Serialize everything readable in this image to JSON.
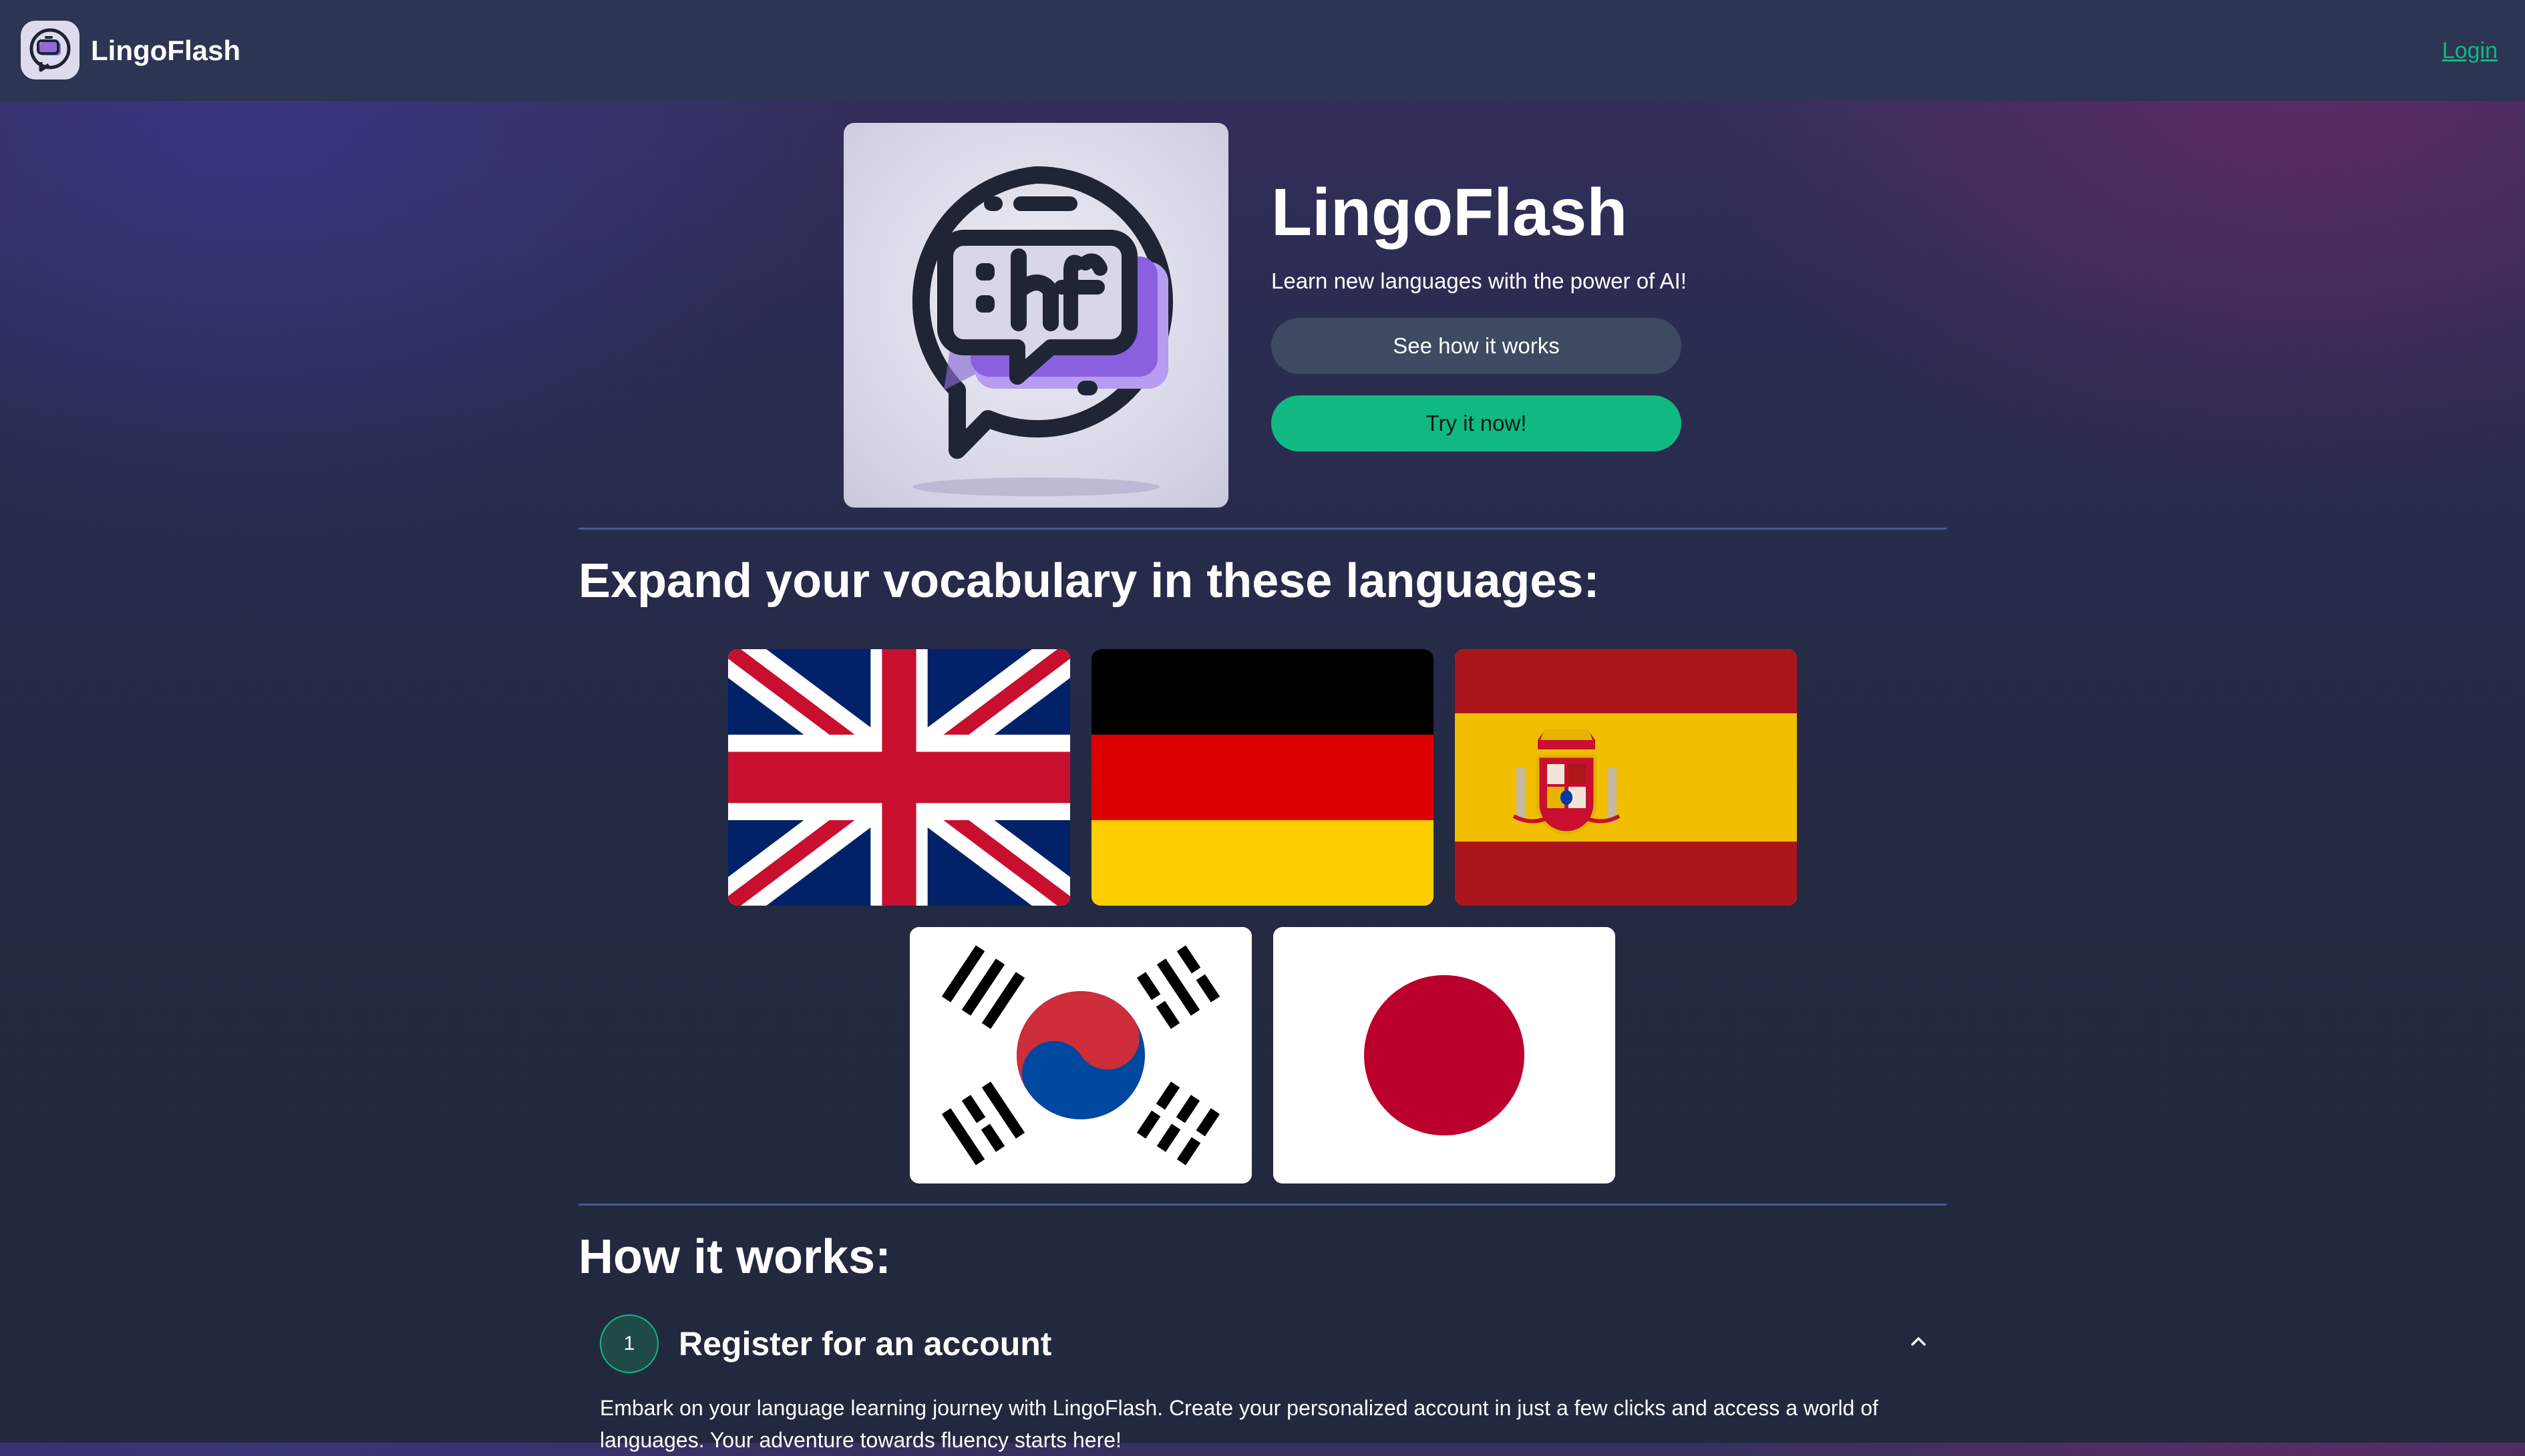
{
  "header": {
    "brand_name": "LingoFlash",
    "login_label": "Login"
  },
  "hero": {
    "title": "LingoFlash",
    "subtitle": "Learn new languages with the power of AI!",
    "secondary_button": "See how it works",
    "primary_button": "Try it now!"
  },
  "languages": {
    "heading": "Expand your vocabulary in these languages:",
    "flags": [
      "united-kingdom",
      "germany",
      "spain",
      "south-korea",
      "japan"
    ]
  },
  "how_it_works": {
    "heading": "How it works:",
    "steps": [
      {
        "number": "1",
        "title": "Register for an account",
        "body": "Embark on your language learning journey with LingoFlash. Create your personalized account in just a few clicks and access a world of languages. Your adventure towards fluency starts here!"
      }
    ]
  },
  "colors": {
    "accent": "#10b981",
    "topbar": "#2d3552",
    "secondary_button": "#3e4a62",
    "divider": "#4a5c8e"
  },
  "icons": [
    "chat-bubble-logo-icon",
    "chevron-up-icon"
  ]
}
